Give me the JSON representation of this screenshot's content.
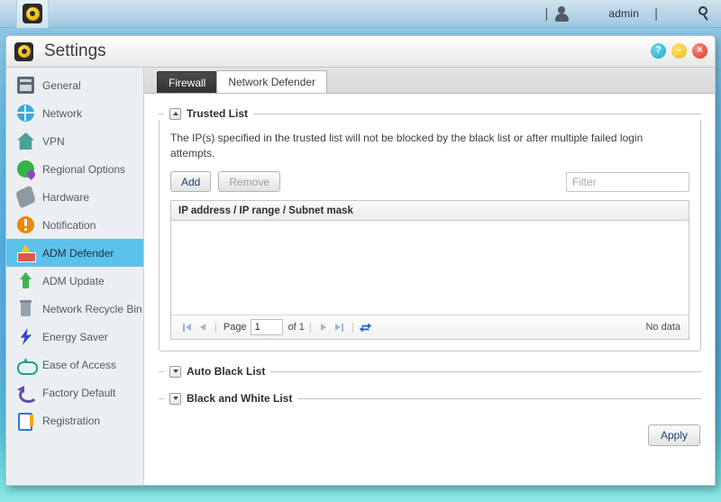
{
  "taskbar": {
    "launcher_icon": "asustor-logo-icon",
    "user_icon": "user-icon",
    "username": "admin",
    "search_icon": "search-icon",
    "separator": "|"
  },
  "window": {
    "title": "Settings",
    "app_icon": "asustor-logo-icon",
    "controls": {
      "help": "?",
      "minimize": "–",
      "close": "×"
    }
  },
  "sidebar": {
    "items": [
      {
        "label": "General",
        "icon": "server-icon",
        "active": false
      },
      {
        "label": "Network",
        "icon": "globe-icon",
        "active": false
      },
      {
        "label": "VPN",
        "icon": "vpn-house-icon",
        "active": false
      },
      {
        "label": "Regional Options",
        "icon": "globe-pin-icon",
        "active": false
      },
      {
        "label": "Hardware",
        "icon": "disk-icon",
        "active": false
      },
      {
        "label": "Notification",
        "icon": "alert-icon",
        "active": false
      },
      {
        "label": "ADM Defender",
        "icon": "firewall-icon",
        "active": true
      },
      {
        "label": "ADM Update",
        "icon": "up-arrow-icon",
        "active": false
      },
      {
        "label": "Network Recycle Bin",
        "icon": "trash-icon",
        "active": false
      },
      {
        "label": "Energy Saver",
        "icon": "lightning-icon",
        "active": false
      },
      {
        "label": "Ease of Access",
        "icon": "cloud-arrow-icon",
        "active": false
      },
      {
        "label": "Factory Default",
        "icon": "undo-arrow-icon",
        "active": false
      },
      {
        "label": "Registration",
        "icon": "clipboard-icon",
        "active": false
      }
    ]
  },
  "tabs": [
    {
      "label": "Firewall",
      "state": "dark"
    },
    {
      "label": "Network Defender",
      "state": "selected"
    }
  ],
  "trusted_list": {
    "title": "Trusted List",
    "expanded": true,
    "toggle_icon": "chevron-up-icon",
    "description": "The IP(s) specified in the trusted list will not be blocked by the black list or after multiple failed login attempts.",
    "add_button": "Add",
    "remove_button": "Remove",
    "remove_disabled": true,
    "filter_placeholder": "Filter",
    "filter_value": "",
    "columns": [
      "IP address / IP range / Subnet mask"
    ],
    "rows": [],
    "pager": {
      "first_icon": "first-page-icon",
      "prev_icon": "previous-page-icon",
      "page_label": "Page",
      "page_value": "1",
      "of_label": "of 1",
      "next_icon": "next-page-icon",
      "last_icon": "last-page-icon",
      "refresh_icon": "refresh-icon",
      "status": "No data"
    }
  },
  "sections": [
    {
      "title": "Auto Black List",
      "expanded": false,
      "toggle_icon": "chevron-down-icon"
    },
    {
      "title": "Black and White List",
      "expanded": false,
      "toggle_icon": "chevron-down-icon"
    }
  ],
  "footer": {
    "apply_button": "Apply"
  },
  "colors": {
    "desktop": "#58aede",
    "accent": "#5cc2ec",
    "tab_active": "#333333",
    "link_text": "#1b3f73",
    "close_button": "#ec4b3c",
    "minimize_button": "#f2c72f",
    "help_button": "#2fb8d4"
  }
}
